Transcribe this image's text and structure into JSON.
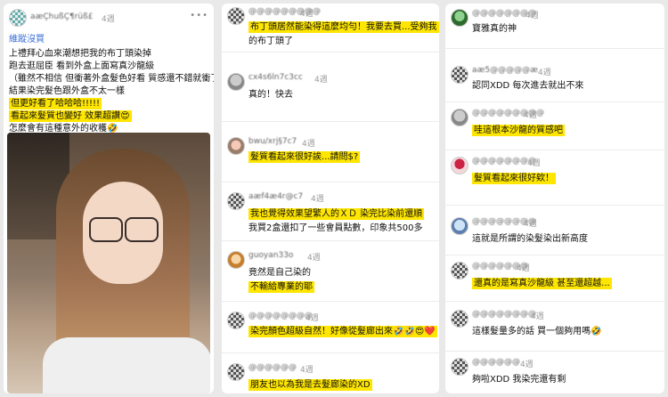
{
  "panel1": {
    "username": "aæÇhußÇ¶rüß£",
    "time": "4週",
    "link": "維蹤沒買",
    "lines": [
      "上禮拜心血來潮想把我的布丁頭染掉",
      "跑去逛屈臣 看到外盒上面寫真沙龍級",
      "（雖然不相信 但衝著外盒髮色好看 質感還不錯就衝了",
      "結果染完髮色跟外盒不太一樣",
      "但更好看了哈哈哈!!!!!",
      "看起來髮質也變好 效果超讚😍",
      "怎麼會有這種意外的收穫🤣"
    ]
  },
  "panel2": {
    "comments": [
      {
        "user": "@@@@@@@@@",
        "time": "4週",
        "lines": [
          "布丁頭居然能染得這麼均勻！我要去買...受夠我",
          "的布丁頭了"
        ],
        "hl": [
          1,
          1
        ]
      },
      {
        "user": "cx4s6ln7c3cc",
        "time": "4週",
        "lines": [
          "真的！快去"
        ],
        "hl": [
          0
        ]
      },
      {
        "user": "bwu/xrj§7c7",
        "time": "4週",
        "lines": [
          "髮質看起來很好誒...請問$?"
        ],
        "hl": [
          1
        ]
      },
      {
        "user": "aæf4æ4r@c7",
        "time": "4週",
        "lines": [
          "我也覺得效果望繁人的ＸＤ 染完比染前還順",
          "我買2盒還扣了一些會員點數，印象共500多"
        ],
        "hl": [
          1,
          0
        ]
      },
      {
        "user": "guoyan33o",
        "time": "4週",
        "lines": [
          "竟然是自己染的",
          "不輸給專業的耶"
        ],
        "hl": [
          0,
          1
        ]
      },
      {
        "user": "@@@@@@@@",
        "time": "4週",
        "lines": [
          "染完顏色超級自然！好像從髮廊出來🤣🤣😍❤️"
        ],
        "hl": [
          1
        ]
      },
      {
        "user": "@@@@@@",
        "time": "4週",
        "lines": [
          "朋友也以為我是去髮廊染的XD"
        ],
        "hl": [
          1
        ]
      }
    ]
  },
  "panel3": {
    "comments": [
      {
        "user": "@@@@@@@@",
        "time": "4週",
        "lines": [
          "寶雅真的神"
        ],
        "hl": [
          0
        ]
      },
      {
        "user": "aæ5@@@@@æ",
        "time": "4週",
        "lines": [
          "認同XDD 每次進去就出不來"
        ],
        "hl": [
          0
        ]
      },
      {
        "user": "@@@@@@@@@",
        "time": "4週",
        "lines": [
          "哇這根本沙龍的質感吧"
        ],
        "hl": [
          1
        ]
      },
      {
        "user": "@@@@@@@@",
        "time": "4週",
        "lines": [
          "髮質看起來很好欸！"
        ],
        "hl": [
          1
        ]
      },
      {
        "user": "@@@@@@@@",
        "time": "4週",
        "lines": [
          "這就是所謂的染髮染出新高度"
        ],
        "hl": [
          0
        ]
      },
      {
        "user": "@@@@@@@",
        "time": "4週",
        "lines": [
          "還真的是寫真沙龍級 甚至還超越..."
        ],
        "hl": [
          1
        ]
      },
      {
        "user": "@@@@@@@@",
        "time": "4週",
        "lines": [
          "這樣髮量多的話 買一個夠用嗎🤣"
        ],
        "hl": [
          0
        ]
      },
      {
        "user": "@@@@@@",
        "time": "4週",
        "lines": [
          "夠啦XDD 我染完還有剩"
        ],
        "hl": [
          0
        ]
      }
    ]
  },
  "icons": {
    "more": "more-icon",
    "photo": "portrait-photo"
  }
}
